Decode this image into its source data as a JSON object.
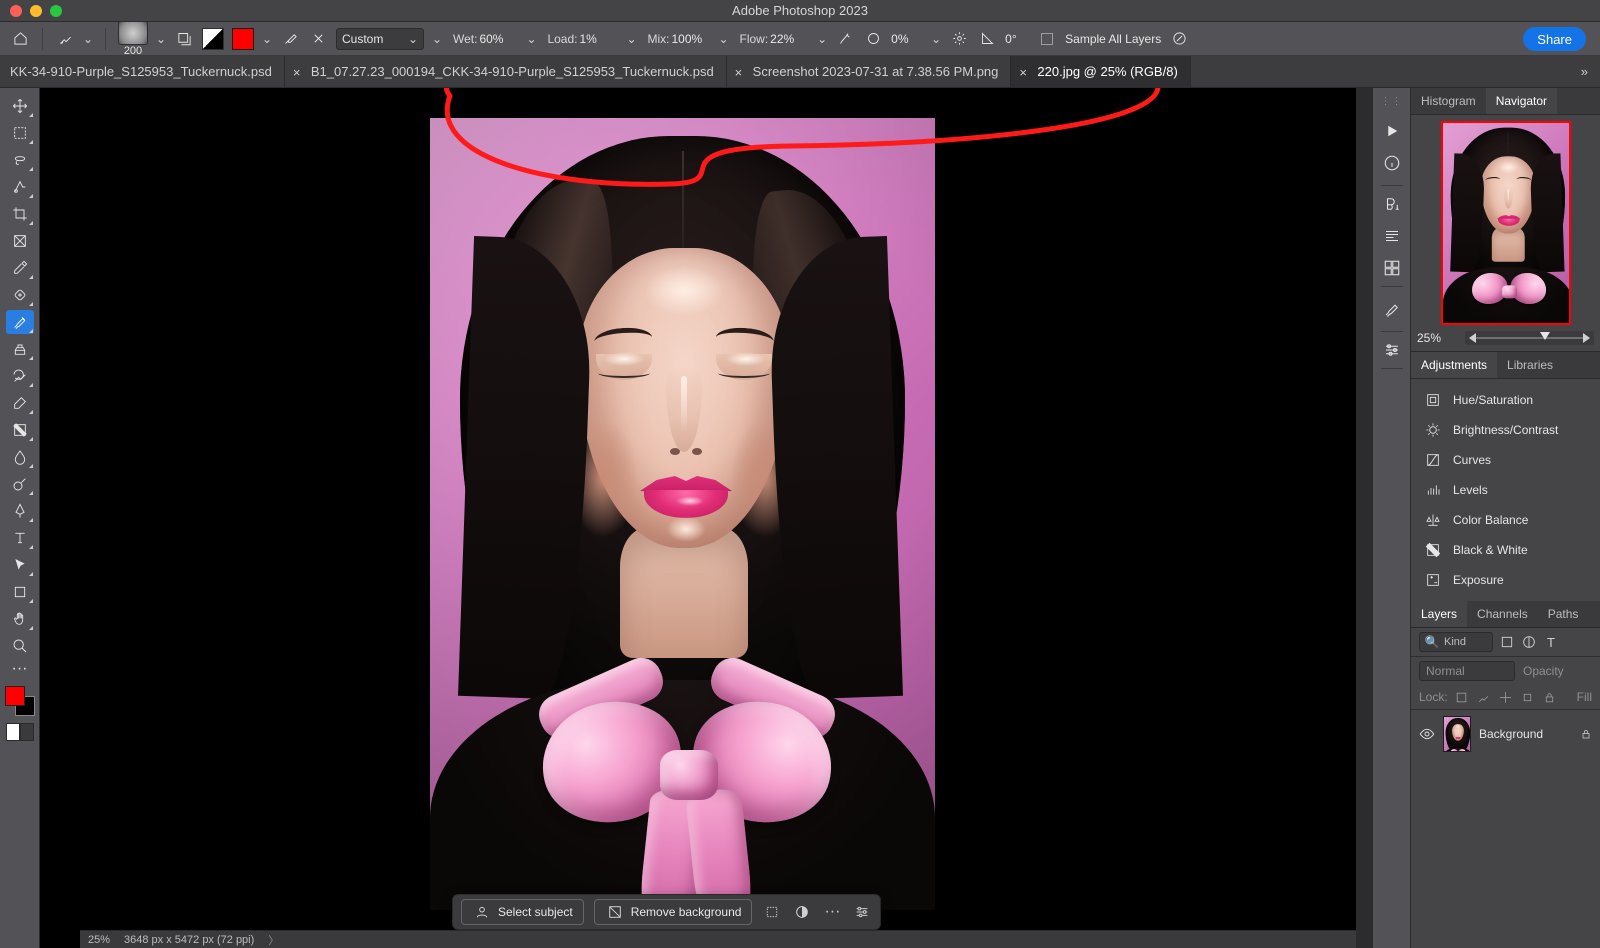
{
  "app": {
    "title": "Adobe Photoshop 2023"
  },
  "colors": {
    "accent": "#1473e6",
    "foreground": "#ff0000",
    "swatch": "#ff0000"
  },
  "options": {
    "brush_size": "200",
    "preset": "Custom",
    "wet": {
      "label": "Wet:",
      "value": "60%"
    },
    "load": {
      "label": "Load:",
      "value": "1%"
    },
    "mix": {
      "label": "Mix:",
      "value": "100%"
    },
    "flow": {
      "label": "Flow:",
      "value": "22%"
    },
    "smoothing": {
      "value": "0%"
    },
    "angle": {
      "value": "0°"
    },
    "sample_all": "Sample All Layers"
  },
  "share": "Share",
  "tabs": [
    {
      "label": "KK-34-910-Purple_S125953_Tuckernuck.psd",
      "active": false
    },
    {
      "label": "B1_07.27.23_000194_CKK-34-910-Purple_S125953_Tuckernuck.psd",
      "active": false
    },
    {
      "label": "Screenshot 2023-07-31 at 7.38.56 PM.png",
      "active": false
    },
    {
      "label": "220.jpg @ 25% (RGB/8)",
      "active": true
    }
  ],
  "context_bar": {
    "select_subject": "Select subject",
    "remove_background": "Remove background"
  },
  "panels": {
    "nav_tabs": [
      "Histogram",
      "Navigator"
    ],
    "nav_active": 1,
    "zoom": "25%",
    "adj_tabs": [
      "Adjustments",
      "Libraries"
    ],
    "adj_active": 0,
    "adjustments": [
      "Hue/Saturation",
      "Brightness/Contrast",
      "Curves",
      "Levels",
      "Color Balance",
      "Black & White",
      "Exposure"
    ],
    "layer_tabs": [
      "Layers",
      "Channels",
      "Paths"
    ],
    "layer_active": 0,
    "kind_placeholder": "Kind",
    "blend_mode": "Normal",
    "opacity_label": "Opacity",
    "lock_label": "Lock:",
    "fill_label": "Fill",
    "layer_name": "Background"
  },
  "status": {
    "zoom": "25%",
    "dims": "3648 px x 5472 px (72 ppi)"
  }
}
